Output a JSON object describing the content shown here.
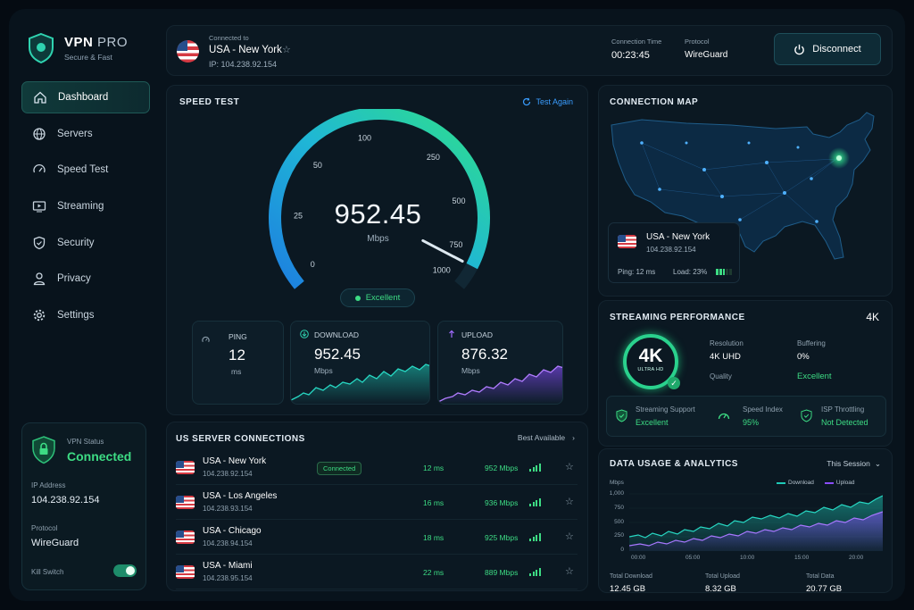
{
  "brand": {
    "name": "VPN",
    "suffix": "PRO",
    "tagline": "Secure & Fast"
  },
  "nav": [
    {
      "label": "Dashboard",
      "icon": "home-icon",
      "active": true
    },
    {
      "label": "Servers",
      "icon": "globe-icon"
    },
    {
      "label": "Speed Test",
      "icon": "speedometer-icon"
    },
    {
      "label": "Streaming",
      "icon": "tv-icon"
    },
    {
      "label": "Security",
      "icon": "shield-icon"
    },
    {
      "label": "Privacy",
      "icon": "user-icon"
    },
    {
      "label": "Settings",
      "icon": "gear-icon"
    }
  ],
  "status": {
    "title": "VPN Status",
    "state": "Connected",
    "ip_label": "IP Address",
    "ip": "104.238.92.154",
    "protocol_label": "Protocol",
    "protocol": "WireGuard",
    "killswitch_label": "Kill Switch",
    "killswitch_on": true
  },
  "top": {
    "connected_to": "Connected to",
    "location": "USA - New York",
    "ip": "IP: 104.238.92.154",
    "time_label": "Connection Time",
    "time": "00:23:45",
    "protocol_label": "Protocol",
    "protocol": "WireGuard",
    "disconnect": "Disconnect"
  },
  "speed": {
    "title": "SPEED TEST",
    "again": "Test Again",
    "value": "952.45",
    "unit": "Mbps",
    "rating": "Excellent",
    "gauge_fraction": 0.952,
    "ticks": [
      "0",
      "25",
      "50",
      "100",
      "100",
      "250",
      "500",
      "750",
      "1000"
    ],
    "ping": {
      "label": "PING",
      "value": "12",
      "unit": "ms"
    },
    "download": {
      "label": "DOWNLOAD",
      "value": "952.45",
      "unit": "Mbps"
    },
    "upload": {
      "label": "UPLOAD",
      "value": "876.32",
      "unit": "Mbps"
    }
  },
  "servers": {
    "title": "US SERVER CONNECTIONS",
    "best": "Best Available",
    "rows": [
      {
        "name": "USA - New York",
        "ip": "104.238.92.154",
        "badge": "Connected",
        "ping": "12 ms",
        "speed": "952 Mbps"
      },
      {
        "name": "USA - Los Angeles",
        "ip": "104.238.93.154",
        "badge": "",
        "ping": "16 ms",
        "speed": "936 Mbps"
      },
      {
        "name": "USA - Chicago",
        "ip": "104.238.94.154",
        "badge": "",
        "ping": "18 ms",
        "speed": "925 Mbps"
      },
      {
        "name": "USA - Miami",
        "ip": "104.238.95.154",
        "badge": "",
        "ping": "22 ms",
        "speed": "889 Mbps"
      }
    ]
  },
  "map": {
    "title": "CONNECTION MAP",
    "location": "USA - New York",
    "ip": "104.238.92.154",
    "ping": "Ping: 12 ms",
    "load": "Load: 23%",
    "load_fraction": 0.23
  },
  "stream": {
    "title": "STREAMING PERFORMANCE",
    "quality_tag": "4K",
    "badge": "4K",
    "badge_sub": "ULTRA HD",
    "resolution_label": "Resolution",
    "resolution": "4K UHD",
    "buffering_label": "Buffering",
    "buffering": "0%",
    "quality_label": "Quality",
    "quality": "Excellent",
    "support_label": "Streaming Support",
    "support": "Excellent",
    "index_label": "Speed Index",
    "index": "95%",
    "isp_label": "ISP Throttling",
    "isp": "Not Detected"
  },
  "usage": {
    "title": "DATA USAGE & ANALYTICS",
    "period": "This Session",
    "yunit": "Mbps",
    "legend_download": "Download",
    "legend_upload": "Upload",
    "yticks": [
      "1,000",
      "750",
      "500",
      "250",
      "0"
    ],
    "xticks": [
      "00:00",
      "05:00",
      "10:00",
      "15:00",
      "20:00"
    ],
    "total_download_label": "Total Download",
    "total_download": "12.45 GB",
    "total_upload_label": "Total Upload",
    "total_upload": "8.32 GB",
    "total_data_label": "Total Data",
    "total_data": "20.77 GB"
  },
  "colors": {
    "accent": "#3ddc84",
    "teal": "#1ec9b7",
    "purple": "#8a4dff",
    "blue": "#2f8cff"
  }
}
